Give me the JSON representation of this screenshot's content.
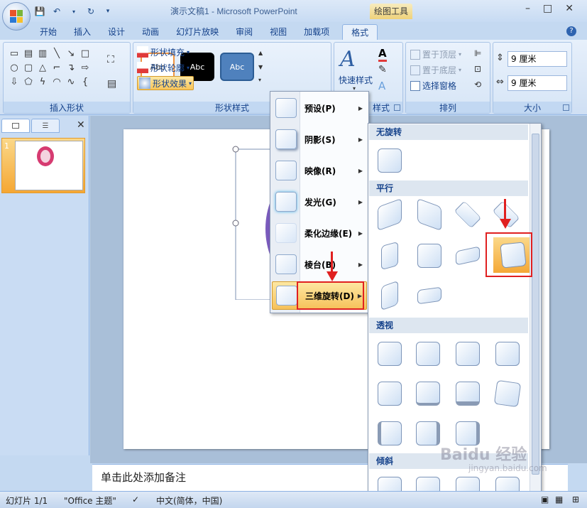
{
  "window": {
    "title": "演示文稿1 - Microsoft PowerPoint",
    "context_tab_title": "绘图工具",
    "controls": [
      "–",
      "□",
      "✕"
    ]
  },
  "tabs": [
    "开始",
    "插入",
    "设计",
    "动画",
    "幻灯片放映",
    "审阅",
    "视图",
    "加载项",
    "格式"
  ],
  "active_tab": "格式",
  "ribbon": {
    "insert_shapes": {
      "label": "插入形状"
    },
    "shape_styles": {
      "label": "形状样式",
      "thumbs": [
        "Abc",
        "Abc",
        "Abc"
      ],
      "fill": "形状填充",
      "outline": "形状轮廓",
      "effects": "形状效果"
    },
    "art_styles": {
      "quick_styles": "快速样式",
      "label": "样式"
    },
    "arrange": {
      "label": "排列",
      "bring_front": "置于顶层",
      "send_back": "置于底层",
      "selection_pane": "选择窗格"
    },
    "size": {
      "label": "大小",
      "height": "9 厘米",
      "width": "9 厘米"
    }
  },
  "slide_panel": {
    "slide_number": "1"
  },
  "notes_placeholder": "单击此处添加备注",
  "effects_menu": {
    "items": [
      "预设(P)",
      "阴影(S)",
      "映像(R)",
      "发光(G)",
      "柔化边缘(E)",
      "棱台(B)",
      "三维旋转(D)"
    ],
    "active": "三维旋转(D)"
  },
  "rotation_gallery": {
    "sections": [
      "无旋转",
      "平行",
      "透视",
      "倾斜"
    ]
  },
  "status": {
    "slide": "幻灯片 1/1",
    "theme": "\"Office 主题\"",
    "language": "中文(简体，中国)"
  },
  "watermark": {
    "brand": "Baidu 经验",
    "url": "jingyan.baidu.com"
  },
  "colors": {
    "accent": "#f6c15a",
    "highlight_box": "#e02020",
    "ribbon": "#dbe7f6"
  }
}
